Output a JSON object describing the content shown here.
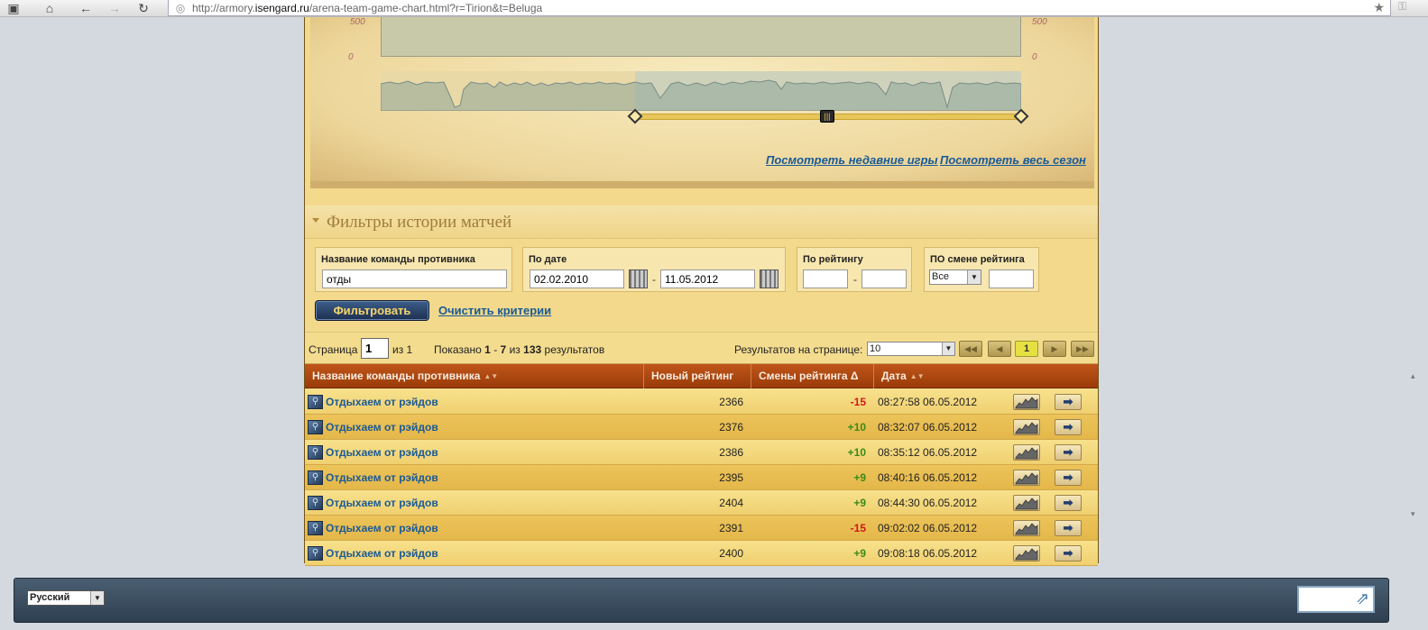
{
  "browser": {
    "url_prefix": "http://armory.",
    "url_host": "isengard.ru",
    "url_path": "/arena-team-game-chart.html?r=Tirion&t=Beluga"
  },
  "chart": {
    "ytick_top": "500",
    "ytick_zero": "0",
    "link_recent": "Посмотреть недавние игры",
    "link_season": "Посмотреть весь сезон"
  },
  "filters": {
    "title": "Фильтры истории матчей",
    "opponent_label": "Название команды противника",
    "opponent_value": "отды",
    "date_label": "По дате",
    "date_from": "02.02.2010",
    "date_to": "11.05.2012",
    "rating_label": "По рейтингу",
    "rating_from": "",
    "rating_to": "",
    "change_label": "ПО смене рейтинга",
    "change_select": "Все",
    "change_value": "",
    "dash": "-",
    "filter_button": "Фильтровать",
    "clear_link": "Очистить критерии"
  },
  "pager": {
    "page_label": "Страница",
    "page_value": "1",
    "of_label": "из 1",
    "shown_prefix": "Показано",
    "shown_from": "1",
    "shown_dash": "-",
    "shown_to": "7",
    "shown_of": "из",
    "shown_total": "133",
    "shown_suffix": "результатов",
    "per_page_label": "Результатов на странице:",
    "per_page_value": "10",
    "current_page": "1"
  },
  "table": {
    "headers": [
      "Название команды противника",
      "Новый рейтинг",
      "Смены рейтинга Δ",
      "Дата"
    ],
    "rows": [
      {
        "team": "Отдыхаем от рэйдов",
        "rating": "2366",
        "delta": "-15",
        "date": "08:27:58 06.05.2012"
      },
      {
        "team": "Отдыхаем от рэйдов",
        "rating": "2376",
        "delta": "+10",
        "date": "08:32:07 06.05.2012"
      },
      {
        "team": "Отдыхаем от рэйдов",
        "rating": "2386",
        "delta": "+10",
        "date": "08:35:12 06.05.2012"
      },
      {
        "team": "Отдыхаем от рэйдов",
        "rating": "2395",
        "delta": "+9",
        "date": "08:40:16 06.05.2012"
      },
      {
        "team": "Отдыхаем от рэйдов",
        "rating": "2404",
        "delta": "+9",
        "date": "08:44:30 06.05.2012"
      },
      {
        "team": "Отдыхаем от рэйдов",
        "rating": "2391",
        "delta": "-15",
        "date": "09:02:02 06.05.2012"
      },
      {
        "team": "Отдыхаем от рэйдов",
        "rating": "2400",
        "delta": "+9",
        "date": "09:08:18 06.05.2012"
      }
    ]
  },
  "footer": {
    "language": "Русский"
  },
  "colors": {
    "positive": "#3c8a16",
    "negative": "#d11a1a",
    "link": "#1a5a96"
  },
  "icons": {
    "home": "home-icon",
    "back": "back-arrow-icon",
    "forward": "forward-arrow-icon",
    "reload": "reload-icon",
    "star": "star-icon",
    "sort": "sort-arrows-icon",
    "team": "team-search-icon",
    "chart": "chart-icon",
    "go": "arrow-right-icon"
  }
}
